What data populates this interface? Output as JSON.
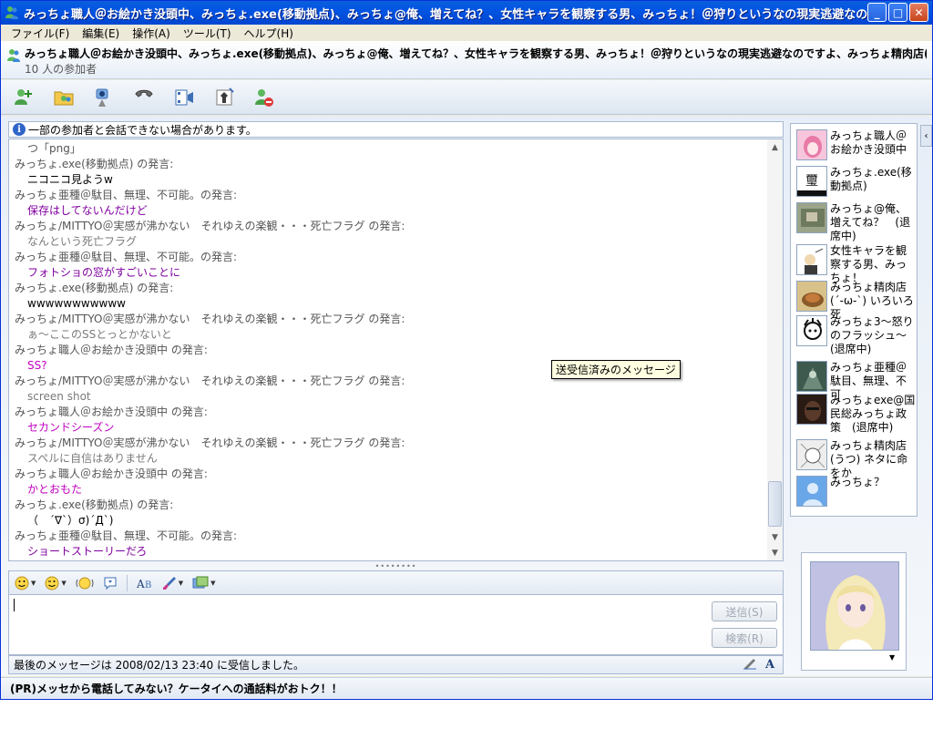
{
  "window": {
    "title": "みっちょ職人＠お絵かき没頭中、みっちょ.exe(移動拠点)、みっちょ@俺、増えてね？、女性キャラを観察する男、みっちょ！＠狩りというなの現実逃避なのですよ、みっ...",
    "buttons": {
      "minimize": "_",
      "maximize": "□",
      "close": "✕"
    }
  },
  "menu": [
    "ファイル(F)",
    "編集(E)",
    "操作(A)",
    "ツール(T)",
    "ヘルプ(H)"
  ],
  "header": {
    "title": "みっちょ職人＠お絵かき没頭中、みっちょ.exe(移動拠点)、みっちょ@俺、増えてね？、女性キャラを観察する男、みっちょ！＠狩りというなの現実逃避なのですよ、みっちょ精肉店(´-ω-`) いろ...",
    "participants": "10 人の参加者"
  },
  "toolbar": [
    "invite-icon",
    "share-folder-icon",
    "video-call-icon",
    "phone-icon",
    "activities-icon",
    "games-icon",
    "block-icon"
  ],
  "notice": "一部の参加者と会話できない場合があります。",
  "chat": [
    {
      "type": "msg-gray",
      "text": "つ「png」"
    },
    {
      "type": "sender",
      "text": "みっちょ.exe(移動拠点) の発言:"
    },
    {
      "type": "msg",
      "text": "ニコニコ見ようw",
      "color": "#000000"
    },
    {
      "type": "sender",
      "text": "みっちょ亜種＠駄目、無理、不可能。の発言:"
    },
    {
      "type": "msg",
      "text": "保存はしてないんだけど",
      "color": "#8000a0"
    },
    {
      "type": "sender",
      "text": "みっちょ/MITTYO＠実感が沸かない　それゆえの楽観・・・死亡フラグ の発言:"
    },
    {
      "type": "msg",
      "text": "なんという死亡フラグ",
      "color": "#7a7a7a"
    },
    {
      "type": "sender",
      "text": "みっちょ亜種＠駄目、無理、不可能。の発言:"
    },
    {
      "type": "msg",
      "text": "フォトショの窓がすごいことに",
      "color": "#8000a0"
    },
    {
      "type": "sender",
      "text": "みっちょ.exe(移動拠点) の発言:"
    },
    {
      "type": "msg",
      "text": "wwwwwwwwwww",
      "color": "#000000"
    },
    {
      "type": "sender",
      "text": "みっちょ/MITTYO＠実感が沸かない　それゆえの楽観・・・死亡フラグ の発言:"
    },
    {
      "type": "msg",
      "text": "ぁ～ここのSSとっとかないと",
      "color": "#7a7a7a"
    },
    {
      "type": "sender",
      "text": "みっちょ職人＠お絵かき没頭中 の発言:"
    },
    {
      "type": "msg",
      "text": "SS?",
      "color": "#c000c0"
    },
    {
      "type": "sender",
      "text": "みっちょ/MITTYO＠実感が沸かない　それゆえの楽観・・・死亡フラグ の発言:"
    },
    {
      "type": "msg",
      "text": "screen shot",
      "color": "#7a7a7a"
    },
    {
      "type": "sender",
      "text": "みっちょ職人＠お絵かき没頭中 の発言:"
    },
    {
      "type": "msg",
      "text": "セカンドシーズン",
      "color": "#c000c0"
    },
    {
      "type": "sender",
      "text": "みっちょ/MITTYO＠実感が沸かない　それゆえの楽観・・・死亡フラグ の発言:"
    },
    {
      "type": "msg",
      "text": "スペルに自信はありません",
      "color": "#7a7a7a"
    },
    {
      "type": "sender",
      "text": "みっちょ職人＠お絵かき没頭中 の発言:"
    },
    {
      "type": "msg",
      "text": "かとおもた",
      "color": "#c000c0"
    },
    {
      "type": "sender",
      "text": "みっちょ.exe(移動拠点) の発言:"
    },
    {
      "type": "msg",
      "text": "（　´∇`）σ)´Д`)",
      "color": "#000000"
    },
    {
      "type": "sender",
      "text": "みっちょ亜種＠駄目、無理、不可能。の発言:"
    },
    {
      "type": "msg",
      "text": "ショートストーリーだろ",
      "color": "#8000a0"
    }
  ],
  "tooltip": "送受信済みのメッセージ",
  "input": {
    "send_label": "送信(S)",
    "search_label": "検索(R)",
    "value": ""
  },
  "status": "最後のメッセージは 2008/02/13 23:40 に受信しました。",
  "roster": [
    {
      "name": "みっちょ職人＠お絵かき没頭中",
      "avatar": "pink-anime-avatar"
    },
    {
      "name": "みっちょ.exe(移動拠点)",
      "avatar": "kanji-avatar"
    },
    {
      "name": "みっちょ@俺、増えてね？　(退席中)",
      "avatar": "photo-avatar"
    },
    {
      "name": "女性キャラを観察する男、みっちょ！",
      "avatar": "figure-avatar"
    },
    {
      "name": "みっちょ精肉店(´-ω-`) いろいろ死",
      "avatar": "food-avatar"
    },
    {
      "name": "みっちょ3～怒りのフラッシュ～　(退席中)",
      "avatar": "sketch-avatar"
    },
    {
      "name": "みっちょ亜種＠駄目、無理、不可",
      "avatar": "game-avatar"
    },
    {
      "name": "みっちょexe@国民総みっちょ政策　(退席中)",
      "avatar": "dark-avatar"
    },
    {
      "name": "みっちょ精肉店(うつ) ネタに命をか",
      "avatar": "manga-avatar"
    },
    {
      "name": "みっちょ？",
      "avatar": "default-user-avatar"
    }
  ],
  "pr": "(PR)メッセから電話してみない？ケータイへの通話料がおトク！！"
}
